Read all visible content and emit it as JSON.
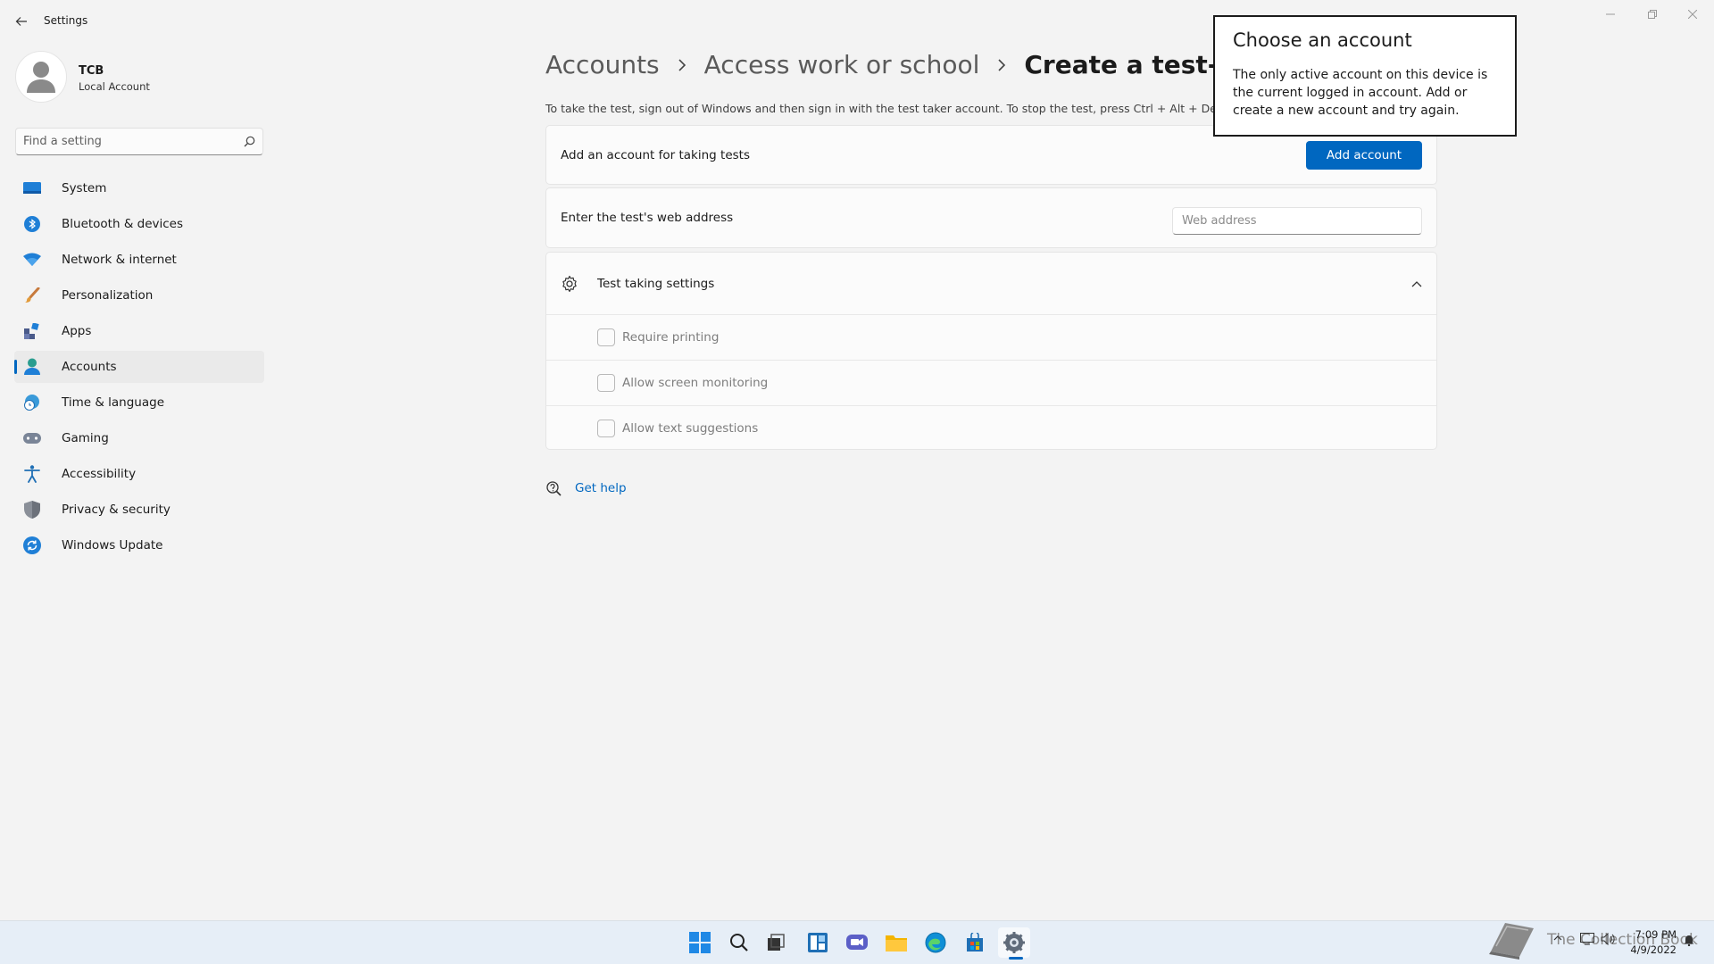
{
  "window": {
    "title": "Settings"
  },
  "profile": {
    "name": "TCB",
    "account_type": "Local Account"
  },
  "search": {
    "placeholder": "Find a setting"
  },
  "sidebar": {
    "items": [
      {
        "label": "System",
        "icon": "system-icon"
      },
      {
        "label": "Bluetooth & devices",
        "icon": "bluetooth-icon"
      },
      {
        "label": "Network & internet",
        "icon": "wifi-icon"
      },
      {
        "label": "Personalization",
        "icon": "brush-icon"
      },
      {
        "label": "Apps",
        "icon": "apps-icon"
      },
      {
        "label": "Accounts",
        "icon": "accounts-icon",
        "active": true
      },
      {
        "label": "Time & language",
        "icon": "globe-clock-icon"
      },
      {
        "label": "Gaming",
        "icon": "gamepad-icon"
      },
      {
        "label": "Accessibility",
        "icon": "accessibility-icon"
      },
      {
        "label": "Privacy & security",
        "icon": "shield-icon"
      },
      {
        "label": "Windows Update",
        "icon": "update-icon"
      }
    ]
  },
  "breadcrumb": {
    "items": [
      "Accounts",
      "Access work or school"
    ],
    "current": "Create a test-taking a"
  },
  "description": "To take the test, sign out of Windows and then sign in with the test taker account. To stop the test, press Ctrl + Alt + Delete.",
  "add_account_card": {
    "label": "Add an account for taking tests",
    "button": "Add account"
  },
  "web_address_card": {
    "label": "Enter the test's web address",
    "placeholder": "Web address"
  },
  "test_settings": {
    "title": "Test taking settings",
    "options": [
      {
        "label": "Require printing",
        "checked": false
      },
      {
        "label": "Allow screen monitoring",
        "checked": false
      },
      {
        "label": "Allow text suggestions",
        "checked": false
      }
    ]
  },
  "help": {
    "label": "Get help"
  },
  "popup": {
    "title": "Choose an account",
    "body": "The only active account on this device is the current logged in account. Add or create a new account and try again."
  },
  "taskbar": {
    "time": "7:09 PM",
    "date": "4/9/2022",
    "watermark": "The Collection Book"
  },
  "colors": {
    "accent": "#0067c0",
    "background": "#f3f3f3",
    "card": "#fbfbfb"
  }
}
